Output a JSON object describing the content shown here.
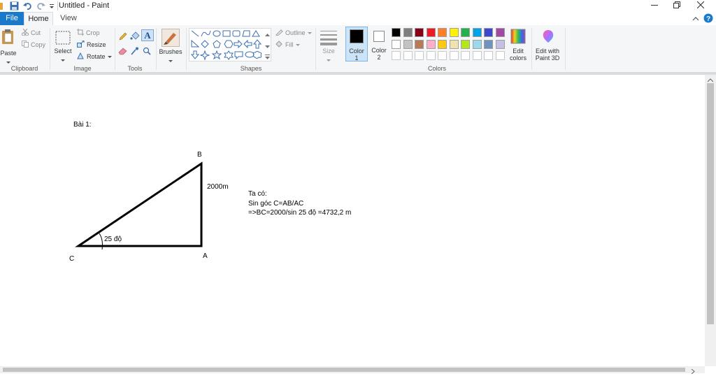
{
  "window": {
    "title": "Untitled - Paint"
  },
  "tabs": {
    "file": "File",
    "home": "Home",
    "view": "View"
  },
  "ribbon": {
    "clipboard": {
      "label": "Clipboard",
      "paste": "Paste",
      "cut": "Cut",
      "copy": "Copy"
    },
    "image": {
      "label": "Image",
      "select": "Select",
      "crop": "Crop",
      "resize": "Resize",
      "rotate": "Rotate"
    },
    "tools": {
      "label": "Tools"
    },
    "brushes": "Brushes",
    "shapes": {
      "label": "Shapes",
      "outline": "Outline",
      "fill": "Fill"
    },
    "size": "Size",
    "colors": {
      "label": "Colors",
      "color1": "Color",
      "color1_num": "1",
      "color2": "Color",
      "color2_num": "2",
      "edit_colors_1": "Edit",
      "edit_colors_2": "colors",
      "paint3d_1": "Edit with",
      "paint3d_2": "Paint 3D",
      "palette_row1": [
        "#000000",
        "#7f7f7f",
        "#880015",
        "#ed1c24",
        "#ff7f27",
        "#fff200",
        "#22b14c",
        "#00a2e8",
        "#3f48cc",
        "#a349a4"
      ],
      "palette_row2": [
        "#ffffff",
        "#c3c3c3",
        "#b97a57",
        "#ffaec9",
        "#ffc90e",
        "#efe4b0",
        "#b5e61d",
        "#99d9ea",
        "#7092be",
        "#c8bfe7"
      ]
    }
  },
  "drawing": {
    "heading": "Bài 1:",
    "vertex_b": "B",
    "vertex_a": "A",
    "vertex_c": "C",
    "side_ab": "2000m",
    "angle_c": "25 độ",
    "line1": "Ta có:",
    "line2": "Sin góc C=AB/AC",
    "line3": "=>BC=2000/sin 25 độ =4732,2 m"
  }
}
